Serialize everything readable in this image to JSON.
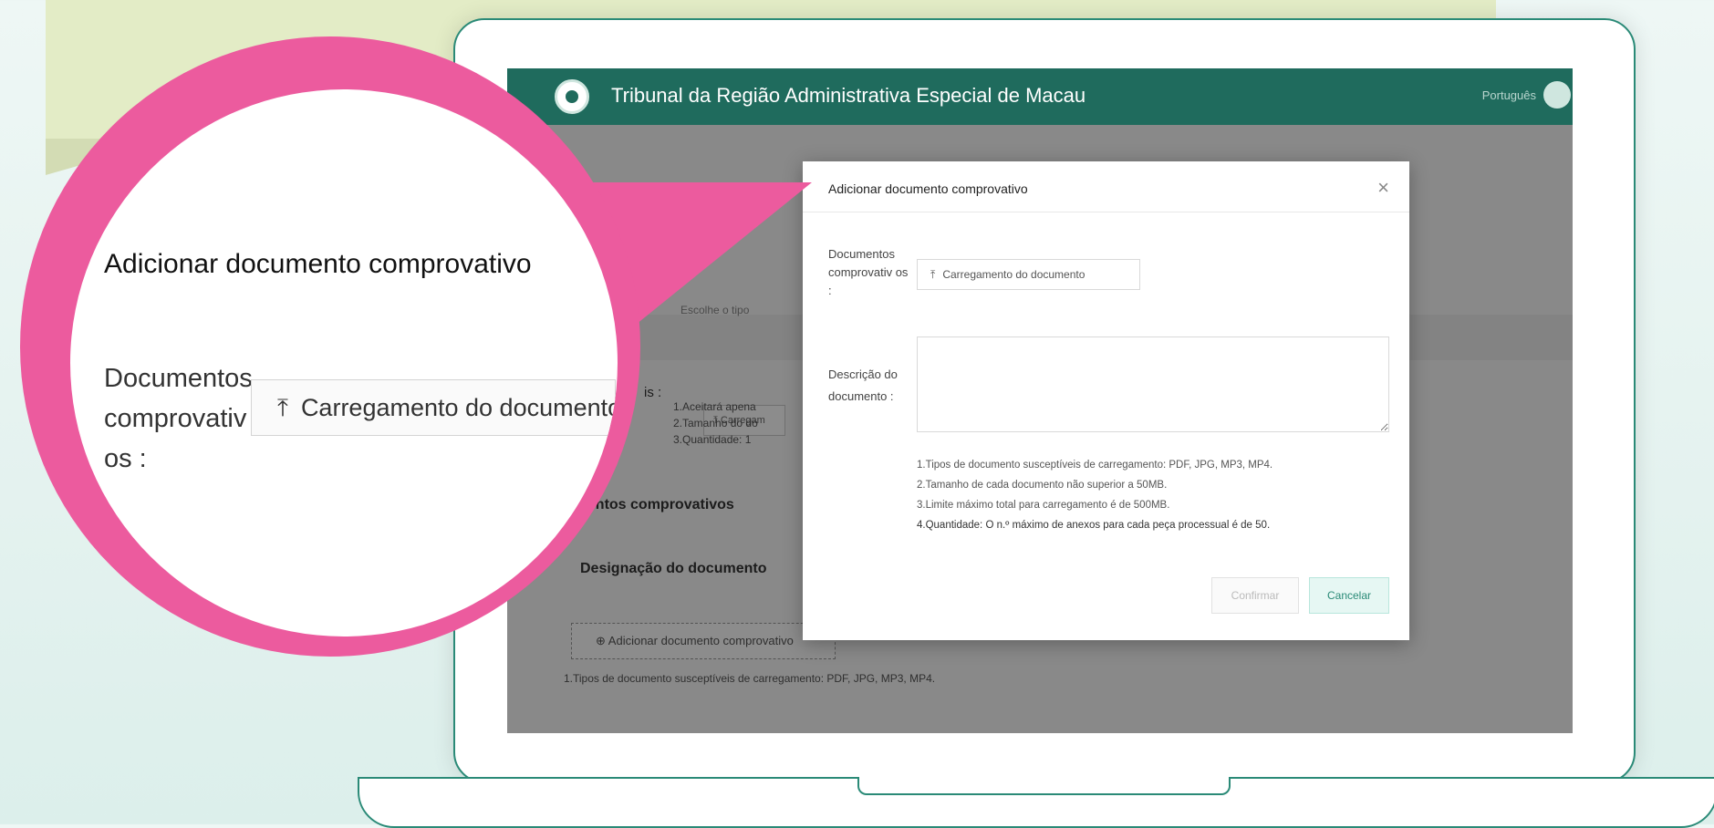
{
  "app": {
    "title": "Tribunal da Região Administrativa Especial de Macau",
    "language": "Português"
  },
  "background_page": {
    "upload_label": "Carregam",
    "upload_hint": "Escolhe o tipo",
    "label_suffix": "is :",
    "notes": [
      "1.Aceitará apena",
      "2.Tamanho do do",
      "3.Quantidade: 1"
    ],
    "section_title": "cumentos comprovativos",
    "column_header": "Designação do documento",
    "add_button": "Adicionar documento comprovativo",
    "footer_note": "1.Tipos de documento susceptíveis de carregamento: PDF, JPG, MP3, MP4."
  },
  "modal": {
    "title": "Adicionar documento comprovativo",
    "close": "×",
    "field_documents_label": "Documentos comprovativ os :",
    "upload_button": "Carregamento do documento",
    "upload_icon": "upload-icon",
    "field_description_label": "Descrição do documento :",
    "description_value": "",
    "notes": [
      "1.Tipos de documento susceptíveis de carregamento: PDF, JPG, MP3, MP4.",
      "2.Tamanho de cada documento não superior a 50MB.",
      "3.Limite máximo total para carregamento é de 500MB.",
      "4.Quantidade: O n.º máximo de anexos para cada peça processual é de 50."
    ],
    "confirm_button": "Confirmar",
    "cancel_button": "Cancelar"
  },
  "magnifier": {
    "title": "Adicionar documento comprovativo",
    "label_line1": "Documentos",
    "label_line2": "comprovativ",
    "label_line3": "os :",
    "upload_button": "Carregamento do documento"
  },
  "colors": {
    "accent": "#1f6b5d",
    "magnifier": "#ec5b9e",
    "laptop_outline": "#2a8a77"
  }
}
